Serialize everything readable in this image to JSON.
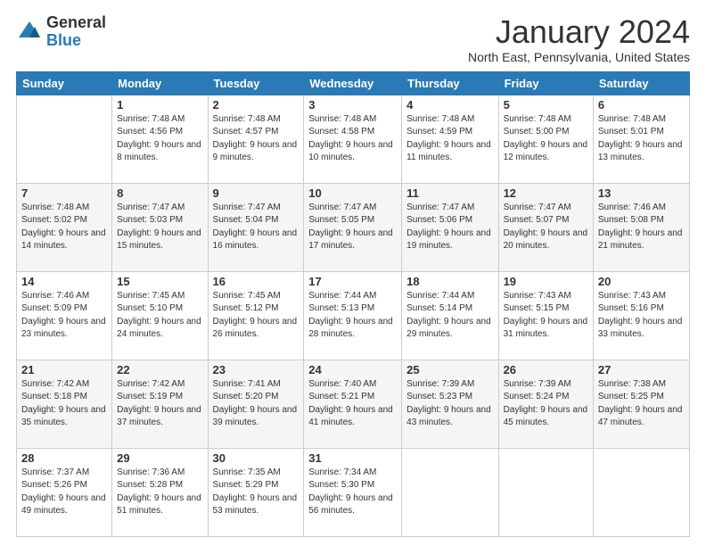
{
  "header": {
    "logo": {
      "general": "General",
      "blue": "Blue",
      "flag_color": "#2a7ab5"
    },
    "title": "January 2024",
    "location": "North East, Pennsylvania, United States"
  },
  "weekdays": [
    "Sunday",
    "Monday",
    "Tuesday",
    "Wednesday",
    "Thursday",
    "Friday",
    "Saturday"
  ],
  "weeks": [
    [
      {
        "day": "",
        "sunrise": "",
        "sunset": "",
        "daylight": ""
      },
      {
        "day": "1",
        "sunrise": "Sunrise: 7:48 AM",
        "sunset": "Sunset: 4:56 PM",
        "daylight": "Daylight: 9 hours and 8 minutes."
      },
      {
        "day": "2",
        "sunrise": "Sunrise: 7:48 AM",
        "sunset": "Sunset: 4:57 PM",
        "daylight": "Daylight: 9 hours and 9 minutes."
      },
      {
        "day": "3",
        "sunrise": "Sunrise: 7:48 AM",
        "sunset": "Sunset: 4:58 PM",
        "daylight": "Daylight: 9 hours and 10 minutes."
      },
      {
        "day": "4",
        "sunrise": "Sunrise: 7:48 AM",
        "sunset": "Sunset: 4:59 PM",
        "daylight": "Daylight: 9 hours and 11 minutes."
      },
      {
        "day": "5",
        "sunrise": "Sunrise: 7:48 AM",
        "sunset": "Sunset: 5:00 PM",
        "daylight": "Daylight: 9 hours and 12 minutes."
      },
      {
        "day": "6",
        "sunrise": "Sunrise: 7:48 AM",
        "sunset": "Sunset: 5:01 PM",
        "daylight": "Daylight: 9 hours and 13 minutes."
      }
    ],
    [
      {
        "day": "7",
        "sunrise": "Sunrise: 7:48 AM",
        "sunset": "Sunset: 5:02 PM",
        "daylight": "Daylight: 9 hours and 14 minutes."
      },
      {
        "day": "8",
        "sunrise": "Sunrise: 7:47 AM",
        "sunset": "Sunset: 5:03 PM",
        "daylight": "Daylight: 9 hours and 15 minutes."
      },
      {
        "day": "9",
        "sunrise": "Sunrise: 7:47 AM",
        "sunset": "Sunset: 5:04 PM",
        "daylight": "Daylight: 9 hours and 16 minutes."
      },
      {
        "day": "10",
        "sunrise": "Sunrise: 7:47 AM",
        "sunset": "Sunset: 5:05 PM",
        "daylight": "Daylight: 9 hours and 17 minutes."
      },
      {
        "day": "11",
        "sunrise": "Sunrise: 7:47 AM",
        "sunset": "Sunset: 5:06 PM",
        "daylight": "Daylight: 9 hours and 19 minutes."
      },
      {
        "day": "12",
        "sunrise": "Sunrise: 7:47 AM",
        "sunset": "Sunset: 5:07 PM",
        "daylight": "Daylight: 9 hours and 20 minutes."
      },
      {
        "day": "13",
        "sunrise": "Sunrise: 7:46 AM",
        "sunset": "Sunset: 5:08 PM",
        "daylight": "Daylight: 9 hours and 21 minutes."
      }
    ],
    [
      {
        "day": "14",
        "sunrise": "Sunrise: 7:46 AM",
        "sunset": "Sunset: 5:09 PM",
        "daylight": "Daylight: 9 hours and 23 minutes."
      },
      {
        "day": "15",
        "sunrise": "Sunrise: 7:45 AM",
        "sunset": "Sunset: 5:10 PM",
        "daylight": "Daylight: 9 hours and 24 minutes."
      },
      {
        "day": "16",
        "sunrise": "Sunrise: 7:45 AM",
        "sunset": "Sunset: 5:12 PM",
        "daylight": "Daylight: 9 hours and 26 minutes."
      },
      {
        "day": "17",
        "sunrise": "Sunrise: 7:44 AM",
        "sunset": "Sunset: 5:13 PM",
        "daylight": "Daylight: 9 hours and 28 minutes."
      },
      {
        "day": "18",
        "sunrise": "Sunrise: 7:44 AM",
        "sunset": "Sunset: 5:14 PM",
        "daylight": "Daylight: 9 hours and 29 minutes."
      },
      {
        "day": "19",
        "sunrise": "Sunrise: 7:43 AM",
        "sunset": "Sunset: 5:15 PM",
        "daylight": "Daylight: 9 hours and 31 minutes."
      },
      {
        "day": "20",
        "sunrise": "Sunrise: 7:43 AM",
        "sunset": "Sunset: 5:16 PM",
        "daylight": "Daylight: 9 hours and 33 minutes."
      }
    ],
    [
      {
        "day": "21",
        "sunrise": "Sunrise: 7:42 AM",
        "sunset": "Sunset: 5:18 PM",
        "daylight": "Daylight: 9 hours and 35 minutes."
      },
      {
        "day": "22",
        "sunrise": "Sunrise: 7:42 AM",
        "sunset": "Sunset: 5:19 PM",
        "daylight": "Daylight: 9 hours and 37 minutes."
      },
      {
        "day": "23",
        "sunrise": "Sunrise: 7:41 AM",
        "sunset": "Sunset: 5:20 PM",
        "daylight": "Daylight: 9 hours and 39 minutes."
      },
      {
        "day": "24",
        "sunrise": "Sunrise: 7:40 AM",
        "sunset": "Sunset: 5:21 PM",
        "daylight": "Daylight: 9 hours and 41 minutes."
      },
      {
        "day": "25",
        "sunrise": "Sunrise: 7:39 AM",
        "sunset": "Sunset: 5:23 PM",
        "daylight": "Daylight: 9 hours and 43 minutes."
      },
      {
        "day": "26",
        "sunrise": "Sunrise: 7:39 AM",
        "sunset": "Sunset: 5:24 PM",
        "daylight": "Daylight: 9 hours and 45 minutes."
      },
      {
        "day": "27",
        "sunrise": "Sunrise: 7:38 AM",
        "sunset": "Sunset: 5:25 PM",
        "daylight": "Daylight: 9 hours and 47 minutes."
      }
    ],
    [
      {
        "day": "28",
        "sunrise": "Sunrise: 7:37 AM",
        "sunset": "Sunset: 5:26 PM",
        "daylight": "Daylight: 9 hours and 49 minutes."
      },
      {
        "day": "29",
        "sunrise": "Sunrise: 7:36 AM",
        "sunset": "Sunset: 5:28 PM",
        "daylight": "Daylight: 9 hours and 51 minutes."
      },
      {
        "day": "30",
        "sunrise": "Sunrise: 7:35 AM",
        "sunset": "Sunset: 5:29 PM",
        "daylight": "Daylight: 9 hours and 53 minutes."
      },
      {
        "day": "31",
        "sunrise": "Sunrise: 7:34 AM",
        "sunset": "Sunset: 5:30 PM",
        "daylight": "Daylight: 9 hours and 56 minutes."
      },
      {
        "day": "",
        "sunrise": "",
        "sunset": "",
        "daylight": ""
      },
      {
        "day": "",
        "sunrise": "",
        "sunset": "",
        "daylight": ""
      },
      {
        "day": "",
        "sunrise": "",
        "sunset": "",
        "daylight": ""
      }
    ]
  ]
}
